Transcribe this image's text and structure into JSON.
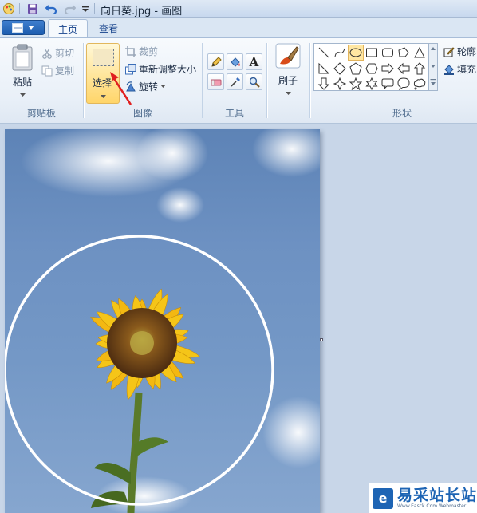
{
  "window": {
    "title": "向日葵.jpg - 画图"
  },
  "tabs": [
    {
      "label": "主页",
      "active": true
    },
    {
      "label": "查看",
      "active": false
    }
  ],
  "clipboard": {
    "paste_label": "粘贴",
    "cut_label": "剪切",
    "copy_label": "复制",
    "group_label": "剪贴板"
  },
  "image": {
    "select_label": "选择",
    "crop_label": "裁剪",
    "resize_label": "重新调整大小",
    "rotate_label": "旋转",
    "group_label": "图像"
  },
  "tools": {
    "group_label": "工具",
    "items": [
      "pencil-icon",
      "fill-bucket-icon",
      "text-icon",
      "eraser-icon",
      "color-picker-icon",
      "magnifier-icon"
    ]
  },
  "brush": {
    "label": "刷子"
  },
  "shapes": {
    "group_label": "形状",
    "outline_label": "轮廓",
    "fill_label": "填充",
    "items": [
      "line",
      "curve",
      "oval",
      "rectangle",
      "rounded-rectangle",
      "polygon",
      "triangle",
      "right-triangle",
      "diamond",
      "pentagon",
      "hexagon",
      "right-arrow",
      "left-arrow",
      "up-arrow",
      "down-arrow",
      "four-point-star",
      "five-point-star",
      "six-point-star",
      "rounded-callout",
      "oval-callout",
      "cloud-callout"
    ],
    "selected": "oval"
  },
  "watermark": {
    "logo_glyph": "e",
    "main": "易采站长站",
    "sub": "Www.Easck.Com Webmaster"
  },
  "colors": {
    "accent": "#1d64b4",
    "selection_highlight": "#ffe59a",
    "arrow": "#e02020",
    "sky": "#6d91c2",
    "petal": "#f5c518"
  }
}
